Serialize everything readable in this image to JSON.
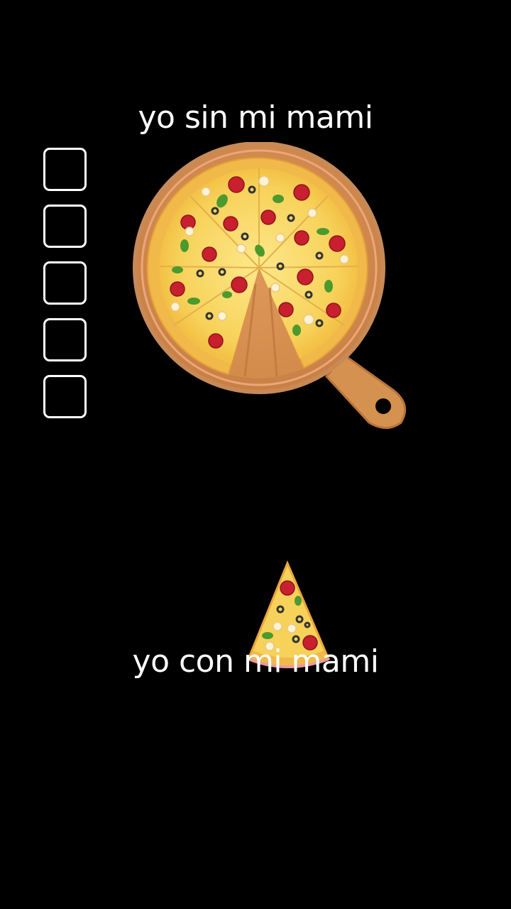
{
  "captions": {
    "top": "yo sin mi mami",
    "bottom": "yo con mi mami"
  },
  "checkboxes": [
    {
      "checked": false
    },
    {
      "checked": false
    },
    {
      "checked": false
    },
    {
      "checked": false
    },
    {
      "checked": false
    }
  ],
  "images": {
    "board": "pizza-on-wooden-board-one-slice-missing",
    "slice": "single-pizza-slice"
  },
  "colors": {
    "background": "#000000",
    "text": "#ffffff",
    "wood": "#d9935a",
    "crust": "#f2c24a",
    "pepperoni": "#c8202e",
    "basil": "#4c9a2e"
  }
}
